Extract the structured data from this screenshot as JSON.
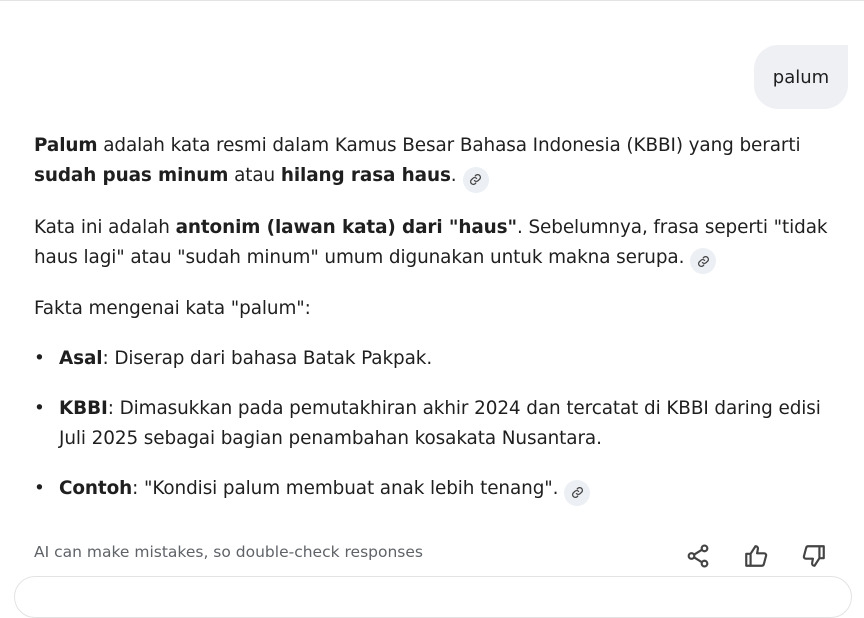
{
  "user_message": "palum",
  "answer": {
    "p1": {
      "t1": "Palum",
      "t2": " adalah kata resmi dalam Kamus Besar Bahasa Indonesia (KBBI) yang berarti ",
      "t3": "sudah puas minum",
      "t4": " atau ",
      "t5": "hilang rasa haus",
      "t6": "."
    },
    "p2": {
      "t1": "Kata ini adalah ",
      "t2": "antonim (lawan kata) dari \"haus\"",
      "t3": ". Sebelumnya, frasa seperti \"tidak haus lagi\" atau \"sudah minum\" umum digunakan untuk makna serupa."
    },
    "p3": "Fakta mengenai kata \"palum\":",
    "bullets": [
      {
        "label": "Asal",
        "text": ": Diserap dari bahasa Batak Pakpak."
      },
      {
        "label": "KBBI",
        "text": ": Dimasukkan pada pemutakhiran akhir 2024 dan tercatat di KBBI daring edisi Juli 2025 sebagai bagian penambahan kosakata Nusantara."
      },
      {
        "label": "Contoh",
        "text": ": \"Kondisi palum membuat anak lebih tenang\"."
      }
    ]
  },
  "disclaimer": "AI can make mistakes, so double-check responses",
  "icons": {
    "link": "link-icon",
    "share": "share-icon",
    "like": "thumbs-up-icon",
    "dislike": "thumbs-down-icon"
  },
  "colors": {
    "bubble_bg": "#eef0f4",
    "chip_bg": "#eceff3",
    "muted_text": "#5f6368"
  }
}
